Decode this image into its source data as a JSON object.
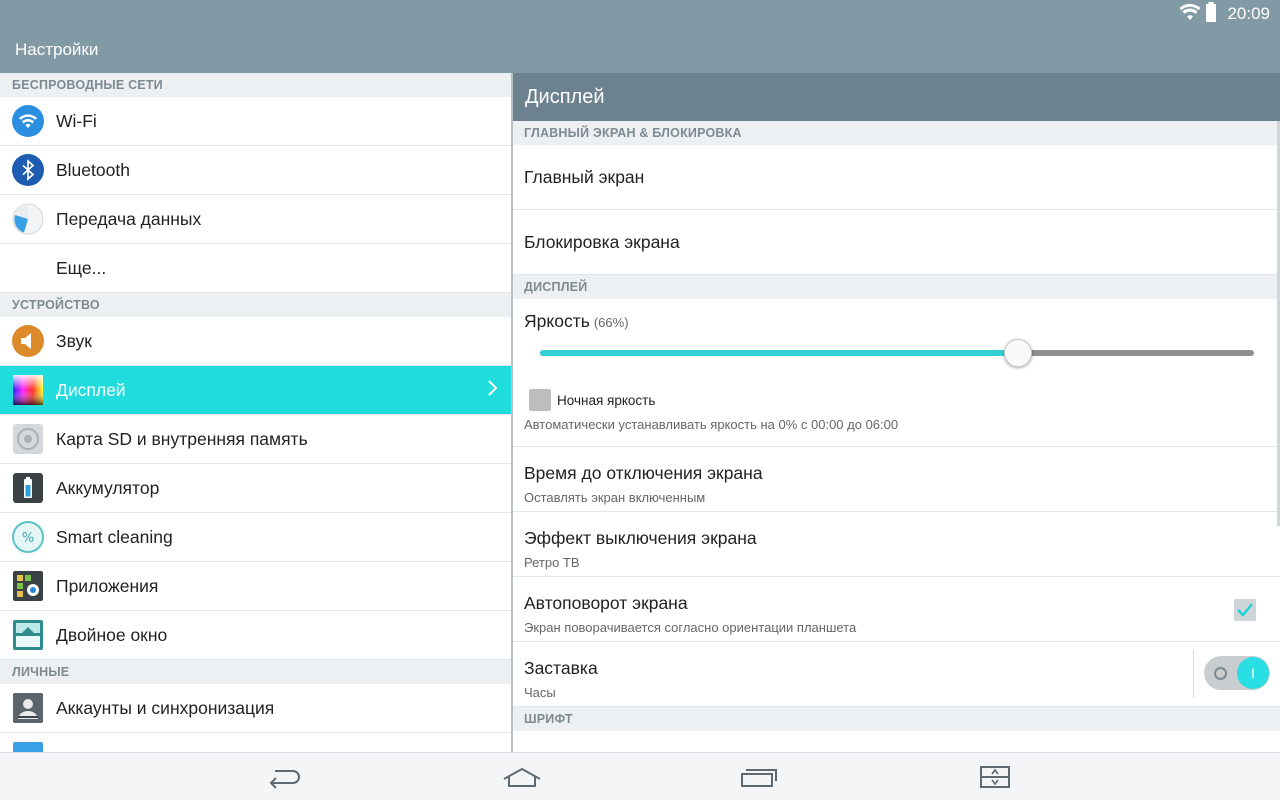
{
  "status": {
    "time": "20:09"
  },
  "app": {
    "title": "Настройки"
  },
  "left": {
    "sections": {
      "wireless": "БЕСПРОВОДНЫЕ СЕТИ",
      "device": "УСТРОЙСТВО",
      "personal": "ЛИЧНЫЕ"
    },
    "items": {
      "wifi": "Wi-Fi",
      "bluetooth": "Bluetooth",
      "data": "Передача данных",
      "more": "Еще...",
      "sound": "Звук",
      "display": "Дисплей",
      "storage": "Карта SD и внутренняя память",
      "battery": "Аккумулятор",
      "smart": "Smart cleaning",
      "apps": "Приложения",
      "dual": "Двойное окно",
      "accounts": "Аккаунты и синхронизация"
    }
  },
  "right": {
    "title": "Дисплей",
    "sections": {
      "home_lock": "ГЛАВНЫЙ ЭКРАН & БЛОКИРОВКА",
      "display": "ДИСПЛЕЙ",
      "font": "ШРИФТ"
    },
    "home_screen": "Главный экран",
    "lock_screen": "Блокировка экрана",
    "brightness": {
      "label": "Яркость",
      "percent_text": "(66%)",
      "level": 0.67,
      "night_label": "Ночная яркость",
      "night_desc": "Автоматически устанавливать яркость на 0% с 00:00 до 06:00"
    },
    "timeout": {
      "title": "Время до отключения экрана",
      "sub": "Оставлять экран включенным"
    },
    "off_effect": {
      "title": "Эффект выключения экрана",
      "sub": "Ретро ТВ"
    },
    "autorotate": {
      "title": "Автоповорот экрана",
      "sub": "Экран поворачивается согласно ориентации планшета",
      "checked": true
    },
    "screensaver": {
      "title": "Заставка",
      "sub": "Часы",
      "on": true,
      "on_glyph": "I"
    }
  },
  "colors": {
    "accent": "#21dcdc",
    "header": "#829aa6",
    "subheader": "#6c828e"
  }
}
